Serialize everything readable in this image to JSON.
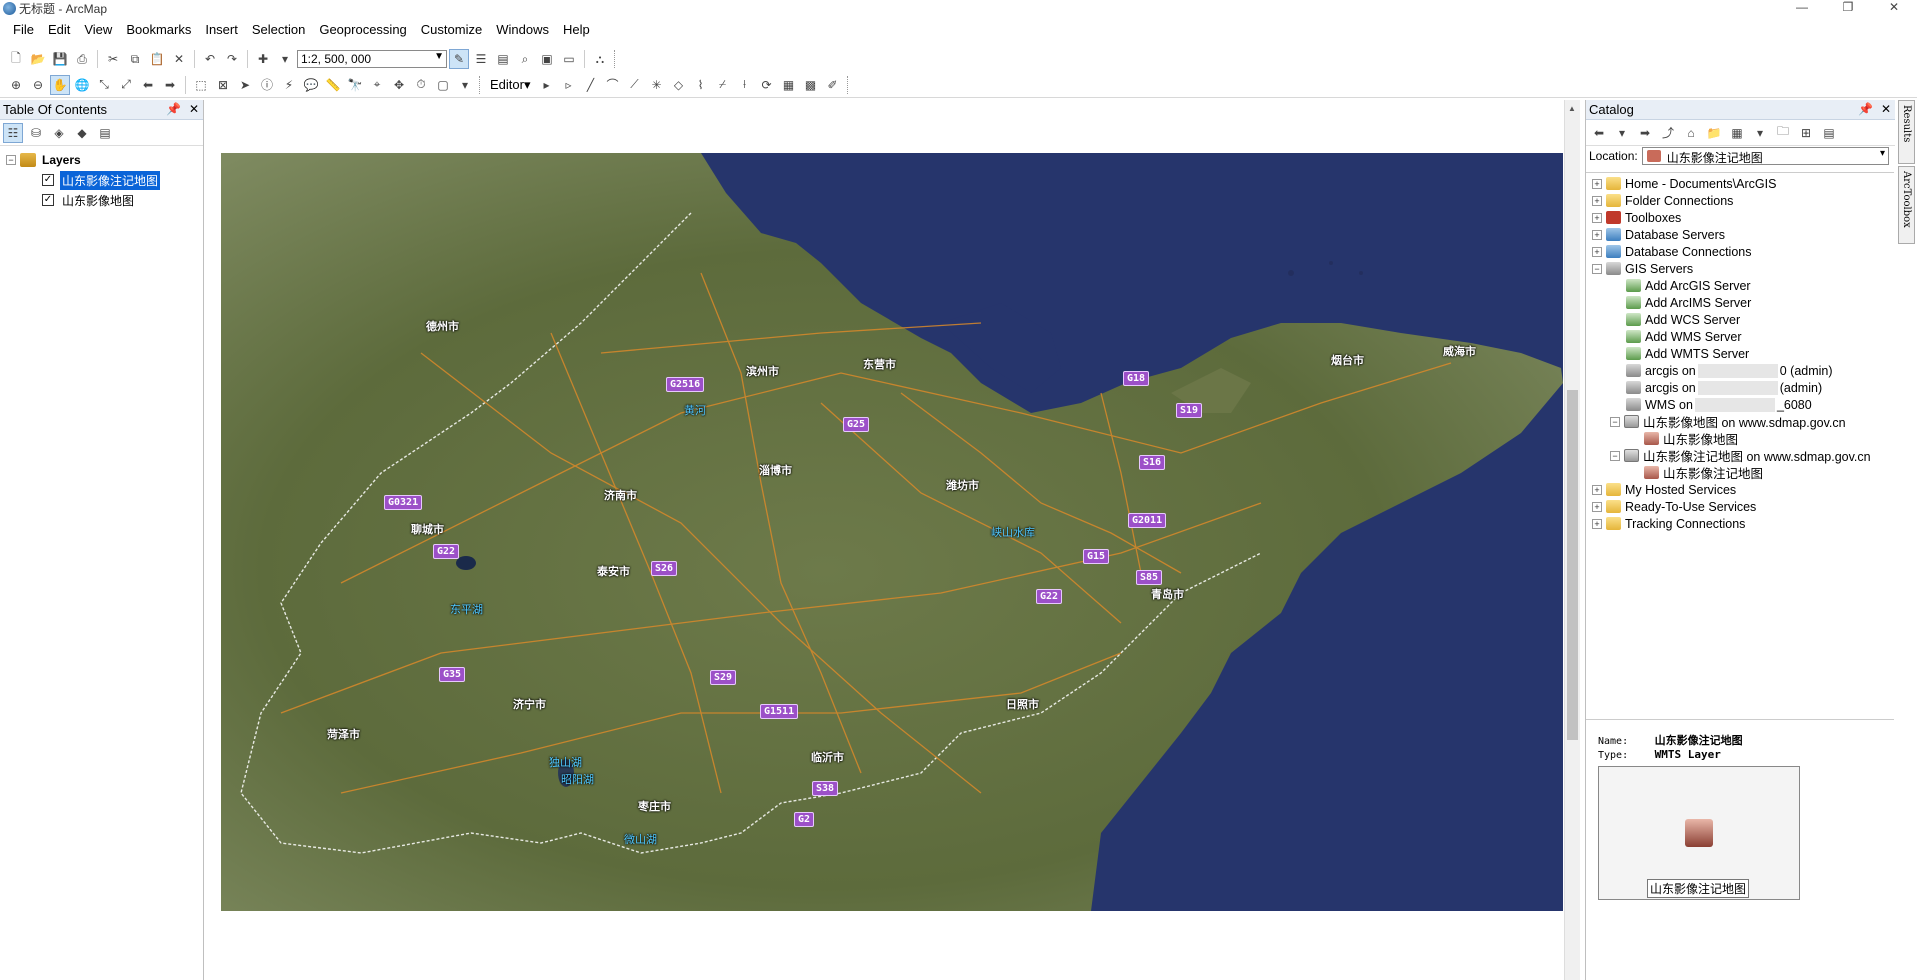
{
  "window": {
    "title": "无标题 - ArcMap",
    "controls": [
      "—",
      "❐",
      "✕"
    ]
  },
  "menu": [
    "File",
    "Edit",
    "View",
    "Bookmarks",
    "Insert",
    "Selection",
    "Geoprocessing",
    "Customize",
    "Windows",
    "Help"
  ],
  "toolbar": {
    "scale": "1:2, 500, 000",
    "editor_label": "Editor▾"
  },
  "toc": {
    "title": "Table Of Contents",
    "root_label": "Layers",
    "layers": [
      {
        "name": "山东影像注记地图",
        "checked": "✓",
        "selected": true
      },
      {
        "name": "山东影像地图",
        "checked": "✓",
        "selected": false
      }
    ]
  },
  "map": {
    "cities": [
      {
        "name": "德州市"
      },
      {
        "name": "滨州市"
      },
      {
        "name": "东营市"
      },
      {
        "name": "烟台市"
      },
      {
        "name": "威海市"
      },
      {
        "name": "淄博市"
      },
      {
        "name": "济南市"
      },
      {
        "name": "潍坊市"
      },
      {
        "name": "聊城市"
      },
      {
        "name": "泰安市"
      },
      {
        "name": "青岛市"
      },
      {
        "name": "济宁市"
      },
      {
        "name": "菏泽市"
      },
      {
        "name": "日照市"
      },
      {
        "name": "临沂市"
      },
      {
        "name": "枣庄市"
      }
    ],
    "water": [
      {
        "name": "黄河"
      },
      {
        "name": "峡山水库"
      },
      {
        "name": "东平湖"
      },
      {
        "name": "独山湖"
      },
      {
        "name": "昭阳湖"
      },
      {
        "name": "微山湖"
      }
    ],
    "roads": [
      "G2516",
      "G25",
      "G18",
      "S19",
      "S16",
      "G0321",
      "G2011",
      "G22",
      "S26",
      "G15",
      "S85",
      "G22",
      "G35",
      "S29",
      "G1511",
      "S38",
      "G2"
    ]
  },
  "catalog": {
    "title": "Catalog",
    "location_label": "Location:",
    "location_value": "山东影像注记地图",
    "tree": {
      "home": "Home - Documents\\ArcGIS",
      "folder_connections": "Folder Connections",
      "toolboxes": "Toolboxes",
      "database_servers": "Database Servers",
      "database_connections": "Database Connections",
      "gis_servers": "GIS Servers",
      "add_arcgis": "Add ArcGIS Server",
      "add_arcims": "Add ArcIMS Server",
      "add_wcs": "Add WCS Server",
      "add_wms": "Add WMS Server",
      "add_wmts": "Add WMTS Server",
      "arcgis1_a": "arcgis on",
      "arcgis1_b": "0 (admin)",
      "arcgis2_a": "arcgis on",
      "arcgis2_b": "(admin)",
      "wms_a": "WMS on",
      "wms_b": "_6080",
      "svc1": "山东影像地图 on www.sdmap.gov.cn",
      "svc1_layer": "山东影像地图",
      "svc2": "山东影像注记地图 on www.sdmap.gov.cn",
      "svc2_layer": "山东影像注记地图",
      "my_hosted": "My Hosted Services",
      "ready": "Ready-To-Use Services",
      "tracking": "Tracking Connections"
    },
    "preview": {
      "name_key": "Name:",
      "name_value": "山东影像注记地图",
      "type_key": "Type:",
      "type_value": "WMTS Layer",
      "thumb_label": "山东影像注记地图"
    }
  },
  "side_tabs": [
    "Results",
    "ArcToolbox"
  ]
}
